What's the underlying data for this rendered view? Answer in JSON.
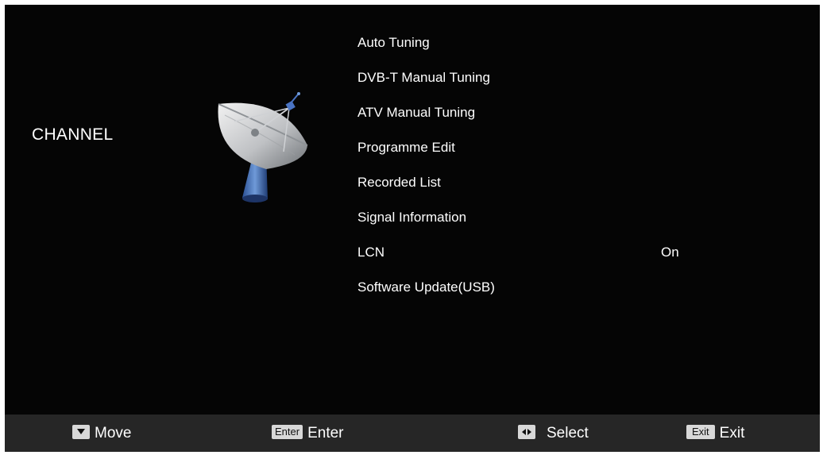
{
  "section": {
    "title": "CHANNEL",
    "icon": "satellite-dish-icon"
  },
  "menu": {
    "items": [
      {
        "label": "Auto Tuning",
        "value": ""
      },
      {
        "label": "DVB-T Manual Tuning",
        "value": ""
      },
      {
        "label": "ATV Manual Tuning",
        "value": ""
      },
      {
        "label": "Programme Edit",
        "value": ""
      },
      {
        "label": "Recorded List",
        "value": ""
      },
      {
        "label": "Signal Information",
        "value": ""
      },
      {
        "label": "LCN",
        "value": "On"
      },
      {
        "label": "Software Update(USB)",
        "value": ""
      }
    ]
  },
  "footer": {
    "move": {
      "key": "down-arrow-key-icon",
      "label": "Move"
    },
    "enter": {
      "key": "Enter",
      "label": "Enter"
    },
    "select": {
      "key": "left-right-arrow-key-icon",
      "label": "Select"
    },
    "exit": {
      "key": "Exit",
      "label": "Exit"
    }
  },
  "colors": {
    "background": "#050505",
    "footer": "#262626",
    "text": "#ffffff",
    "key": "#d8d8d8"
  }
}
